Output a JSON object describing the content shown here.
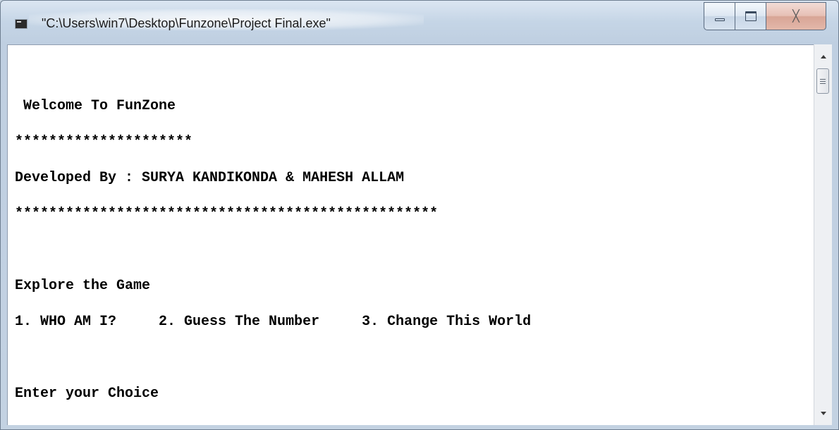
{
  "window": {
    "title": "\"C:\\Users\\win7\\Desktop\\Funzone\\Project Final.exe\"",
    "icon": "console-app-icon",
    "buttons": {
      "minimize": "minimize-icon",
      "maximize": "maximize-icon",
      "close": "close-icon",
      "close_glyph": "╳"
    }
  },
  "console": {
    "lines": [
      " Welcome To FunZone",
      "*********************",
      "Developed By : SURYA KANDIKONDA & MAHESH ALLAM",
      "**************************************************",
      "",
      "Explore the Game",
      "1. WHO AM I?     2. Guess The Number     3. Change This World",
      "",
      "Enter your Choice"
    ]
  },
  "scrollbar": {
    "up_icon": "scroll-up-arrow-icon",
    "down_icon": "scroll-down-arrow-icon"
  }
}
